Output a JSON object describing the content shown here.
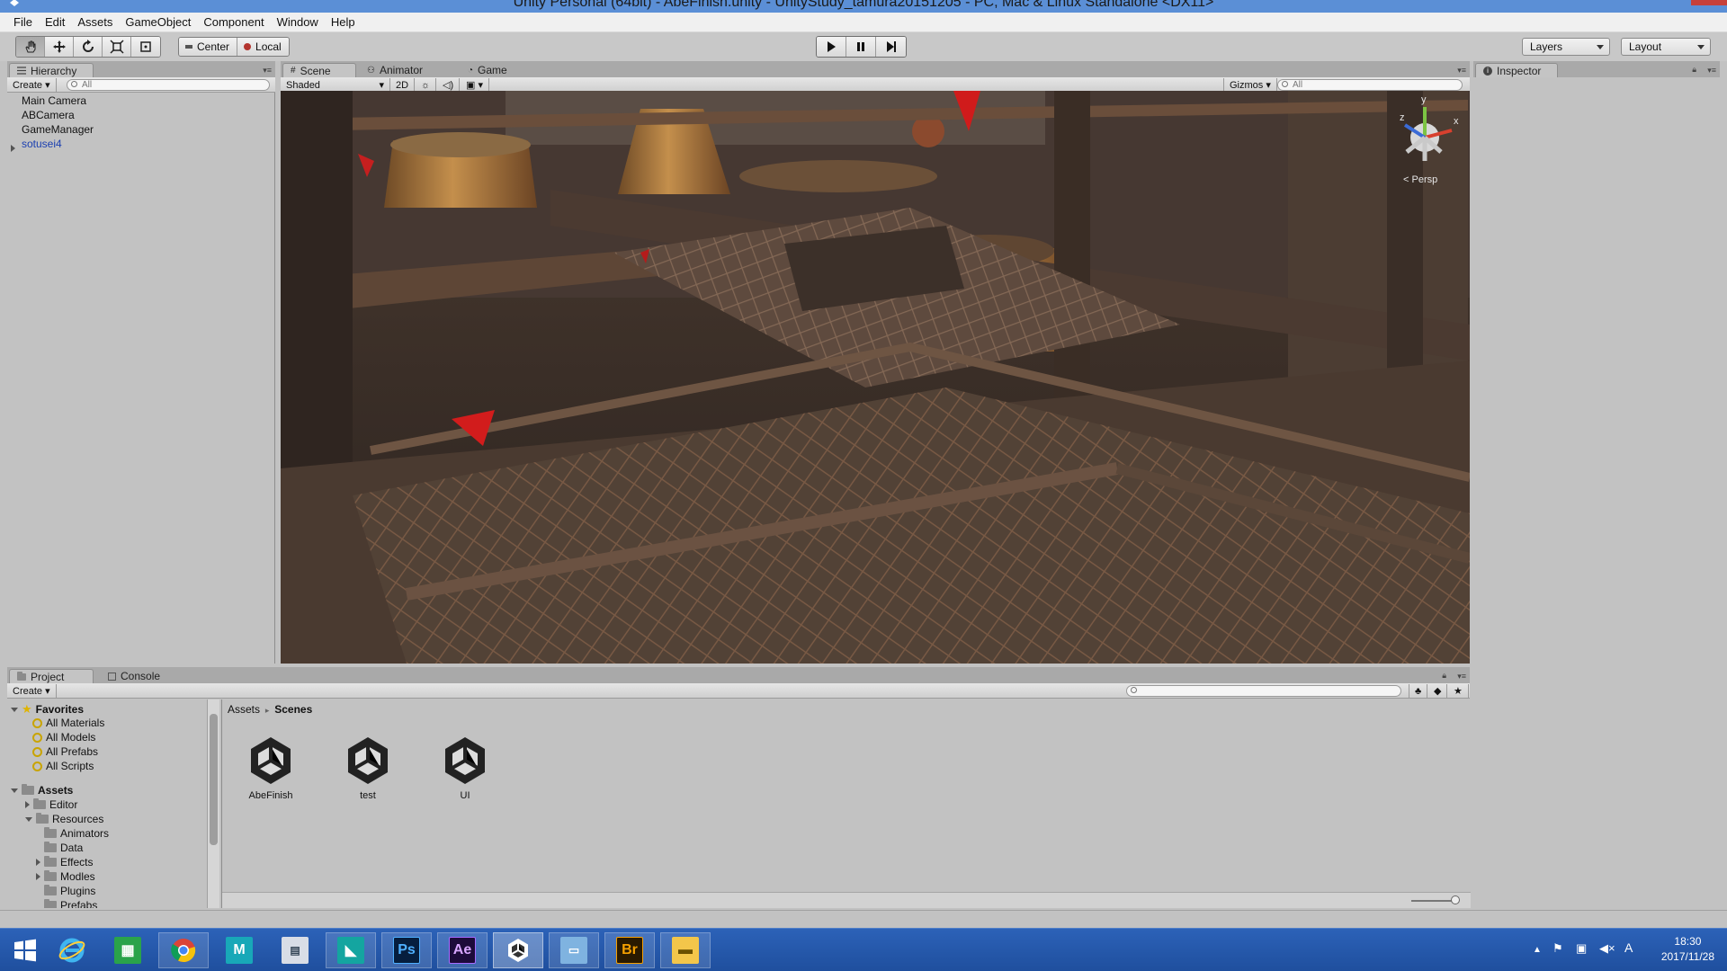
{
  "window": {
    "title": "Unity Personal (64bit) - AbeFinish.unity - UnityStudy_tamura20151205 - PC, Mac & Linux Standalone <DX11>"
  },
  "menu": [
    "File",
    "Edit",
    "Assets",
    "GameObject",
    "Component",
    "Window",
    "Help"
  ],
  "toolbar": {
    "pivot_center": "Center",
    "pivot_local": "Local",
    "layers_label": "Layers",
    "layout_label": "Layout"
  },
  "hierarchy": {
    "tab": "Hierarchy",
    "create_label": "Create",
    "search_placeholder": "All",
    "items": [
      "Main Camera",
      "ABCamera",
      "GameManager",
      "sotusei4"
    ]
  },
  "scene": {
    "tabs": [
      "Scene",
      "Animator",
      "Game"
    ],
    "shading_mode": "Shaded",
    "mode_2d": "2D",
    "gizmos_label": "Gizmos",
    "search_placeholder": "All",
    "gizmo_axes": {
      "x": "x",
      "y": "y",
      "z": "z"
    },
    "projection_label": "Persp"
  },
  "inspector": {
    "tab": "Inspector"
  },
  "project": {
    "tabs": [
      "Project",
      "Console"
    ],
    "create_label": "Create",
    "favorites_label": "Favorites",
    "favorites": [
      "All Materials",
      "All Models",
      "All Prefabs",
      "All Scripts"
    ],
    "assets_label": "Assets",
    "folders": [
      "Editor",
      "Resources",
      "Animators",
      "Data",
      "Effects",
      "Modles",
      "Plugins",
      "Prefabs"
    ],
    "breadcrumb": [
      "Assets",
      "Scenes"
    ],
    "files": [
      "AbeFinish",
      "test",
      "UI"
    ]
  },
  "taskbar": {
    "apps": [
      "windows-start",
      "internet-explorer",
      "windows-store",
      "chrome",
      "autodesk-maya",
      "calculator",
      "unity-hub",
      "photoshop",
      "after-effects",
      "unity",
      "image-viewer",
      "bridge",
      "file-explorer"
    ],
    "photoshop_label": "Ps",
    "after_effects_label": "Ae",
    "bridge_label": "Br",
    "ime_label": "A",
    "time": "18:30",
    "date": "2017/11/28"
  }
}
